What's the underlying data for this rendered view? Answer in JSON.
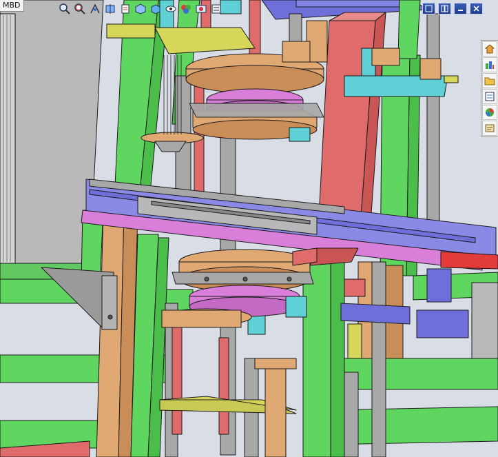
{
  "feature_tree": {
    "tab_label": "MBD"
  },
  "heads_up_toolbar": {
    "tools": [
      "zoom-to-fit-icon",
      "zoom-to-area-icon",
      "previous-view-icon",
      "section-view-icon",
      "dynamic-annotation-icon",
      "view-orientation-icon",
      "display-style-icon",
      "hide-show-items-icon",
      "edit-appearance-icon",
      "apply-scene-icon",
      "view-settings-icon"
    ]
  },
  "window_controls": [
    "restore-icon",
    "tile-icon",
    "minimize-icon",
    "close-icon"
  ],
  "task_pane": [
    "solidworks-resources-icon",
    "design-library-icon",
    "file-explorer-icon",
    "view-palette-icon",
    "appearances-icon",
    "custom-properties-icon"
  ],
  "colors": {
    "background": "#d9dde6",
    "frame_green": "#5fd65f",
    "frame_tan": "#e0a872",
    "post_red": "#e06b6b",
    "plate_purple": "#d97ed9",
    "plate_violet": "#6f6fd9",
    "rod_gray": "#a8a8a8",
    "cyan_block": "#5fd0d6",
    "yellow_plate": "#d6d65a",
    "edge": "#1a1a1a"
  }
}
